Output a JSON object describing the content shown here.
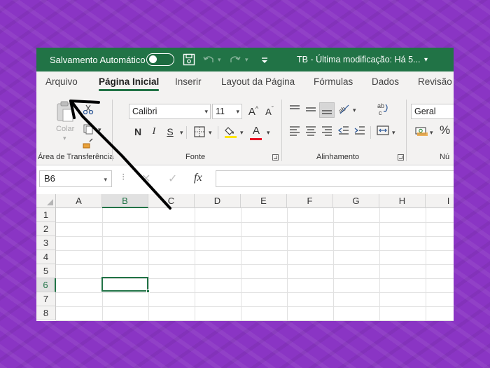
{
  "titlebar": {
    "autosave_label": "Salvamento Automático",
    "doc_title": "TB  -  Última modificação: Há 5...",
    "title_caret": "▾"
  },
  "tabs": [
    "Arquivo",
    "Página Inicial",
    "Inserir",
    "Layout da Página",
    "Fórmulas",
    "Dados",
    "Revisão"
  ],
  "ribbon": {
    "clipboard": {
      "paste_label": "Colar",
      "group_label": "Área de Transferência"
    },
    "font": {
      "font_name": "Calibri",
      "font_size": "11",
      "grow_label": "A",
      "shrink_label": "A",
      "bold_label": "N",
      "italic_label": "I",
      "underline_label": "S",
      "font_color_label": "A",
      "group_label": "Fonte"
    },
    "alignment": {
      "group_label": "Alinhamento",
      "wrap_icon_text": "ab\nc"
    },
    "number": {
      "format": "Geral",
      "group_label": "Nú",
      "percent_label": "%"
    }
  },
  "formula_bar": {
    "name_box": "B6",
    "cancel_icon": "✕",
    "enter_icon": "✓",
    "fx_label": "fx",
    "value": ""
  },
  "grid": {
    "columns": [
      "A",
      "B",
      "C",
      "D",
      "E",
      "F",
      "G",
      "H",
      "I"
    ],
    "rows": [
      "1",
      "2",
      "3",
      "4",
      "5",
      "6",
      "7",
      "8"
    ],
    "selected_column": "B",
    "selected_row": "6"
  },
  "colors": {
    "accent": "#217346",
    "background": "#8a35c4"
  }
}
